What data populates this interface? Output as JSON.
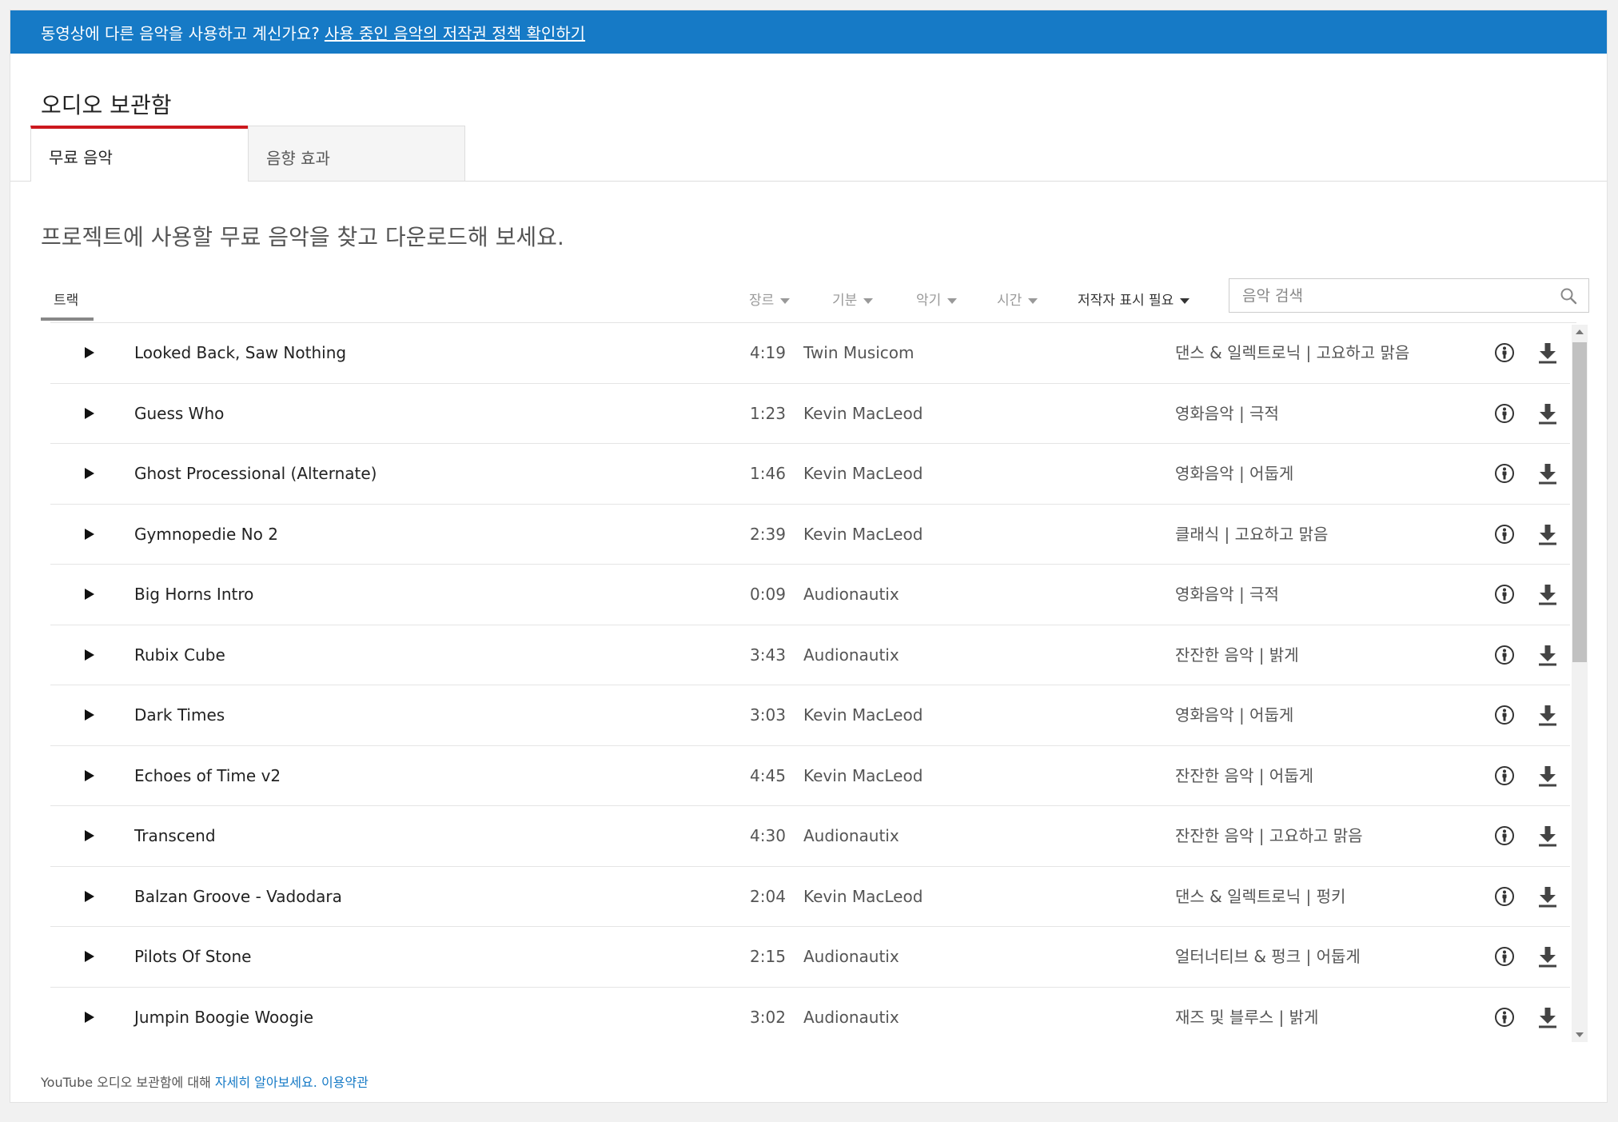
{
  "banner": {
    "text": "동영상에 다른 음악을 사용하고 계신가요?",
    "link": "사용 중인 음악의 저작권 정책 확인하기",
    "color": "#167ac6"
  },
  "title": "오디오 보관함",
  "tabs": [
    {
      "label": "무료 음악",
      "active": true
    },
    {
      "label": "음향 효과",
      "active": false
    }
  ],
  "subtitle": "프로젝트에 사용할 무료 음악을 찾고 다운로드해 보세요.",
  "filters": {
    "track": "트랙",
    "genre": "장르",
    "mood": "기분",
    "instrument": "악기",
    "duration": "시간",
    "attribution": "저작자 표시 필요"
  },
  "search": {
    "placeholder": "음악 검색",
    "icon": "search-icon"
  },
  "tracks": [
    {
      "title": "Looked Back, Saw Nothing",
      "duration": "4:19",
      "artist": "Twin Musicom",
      "genre": "댄스 & 일렉트로닉 | 고요하고 맑음"
    },
    {
      "title": "Guess Who",
      "duration": "1:23",
      "artist": "Kevin MacLeod",
      "genre": "영화음악 | 극적"
    },
    {
      "title": "Ghost Processional (Alternate)",
      "duration": "1:46",
      "artist": "Kevin MacLeod",
      "genre": "영화음악 | 어둡게"
    },
    {
      "title": "Gymnopedie No 2",
      "duration": "2:39",
      "artist": "Kevin MacLeod",
      "genre": "클래식 | 고요하고 맑음"
    },
    {
      "title": "Big Horns Intro",
      "duration": "0:09",
      "artist": "Audionautix",
      "genre": "영화음악 | 극적"
    },
    {
      "title": "Rubix Cube",
      "duration": "3:43",
      "artist": "Audionautix",
      "genre": "잔잔한 음악 | 밝게"
    },
    {
      "title": "Dark Times",
      "duration": "3:03",
      "artist": "Kevin MacLeod",
      "genre": "영화음악 | 어둡게"
    },
    {
      "title": "Echoes of Time v2",
      "duration": "4:45",
      "artist": "Kevin MacLeod",
      "genre": "잔잔한 음악 | 어둡게"
    },
    {
      "title": "Transcend",
      "duration": "4:30",
      "artist": "Audionautix",
      "genre": "잔잔한 음악 | 고요하고 맑음"
    },
    {
      "title": "Balzan Groove - Vadodara",
      "duration": "2:04",
      "artist": "Kevin MacLeod",
      "genre": "댄스 & 일렉트로닉 | 펑키"
    },
    {
      "title": "Pilots Of Stone",
      "duration": "2:15",
      "artist": "Audionautix",
      "genre": "얼터너티브 & 펑크 | 어둡게"
    },
    {
      "title": "Jumpin Boogie Woogie",
      "duration": "3:02",
      "artist": "Audionautix",
      "genre": "재즈 및 블루스 | 밝게"
    }
  ],
  "footer": {
    "text": "YouTube 오디오 보관함에 대해",
    "learn_more": "자세히 알아보세요.",
    "terms": "이용약관"
  },
  "accent": "#cc181e"
}
